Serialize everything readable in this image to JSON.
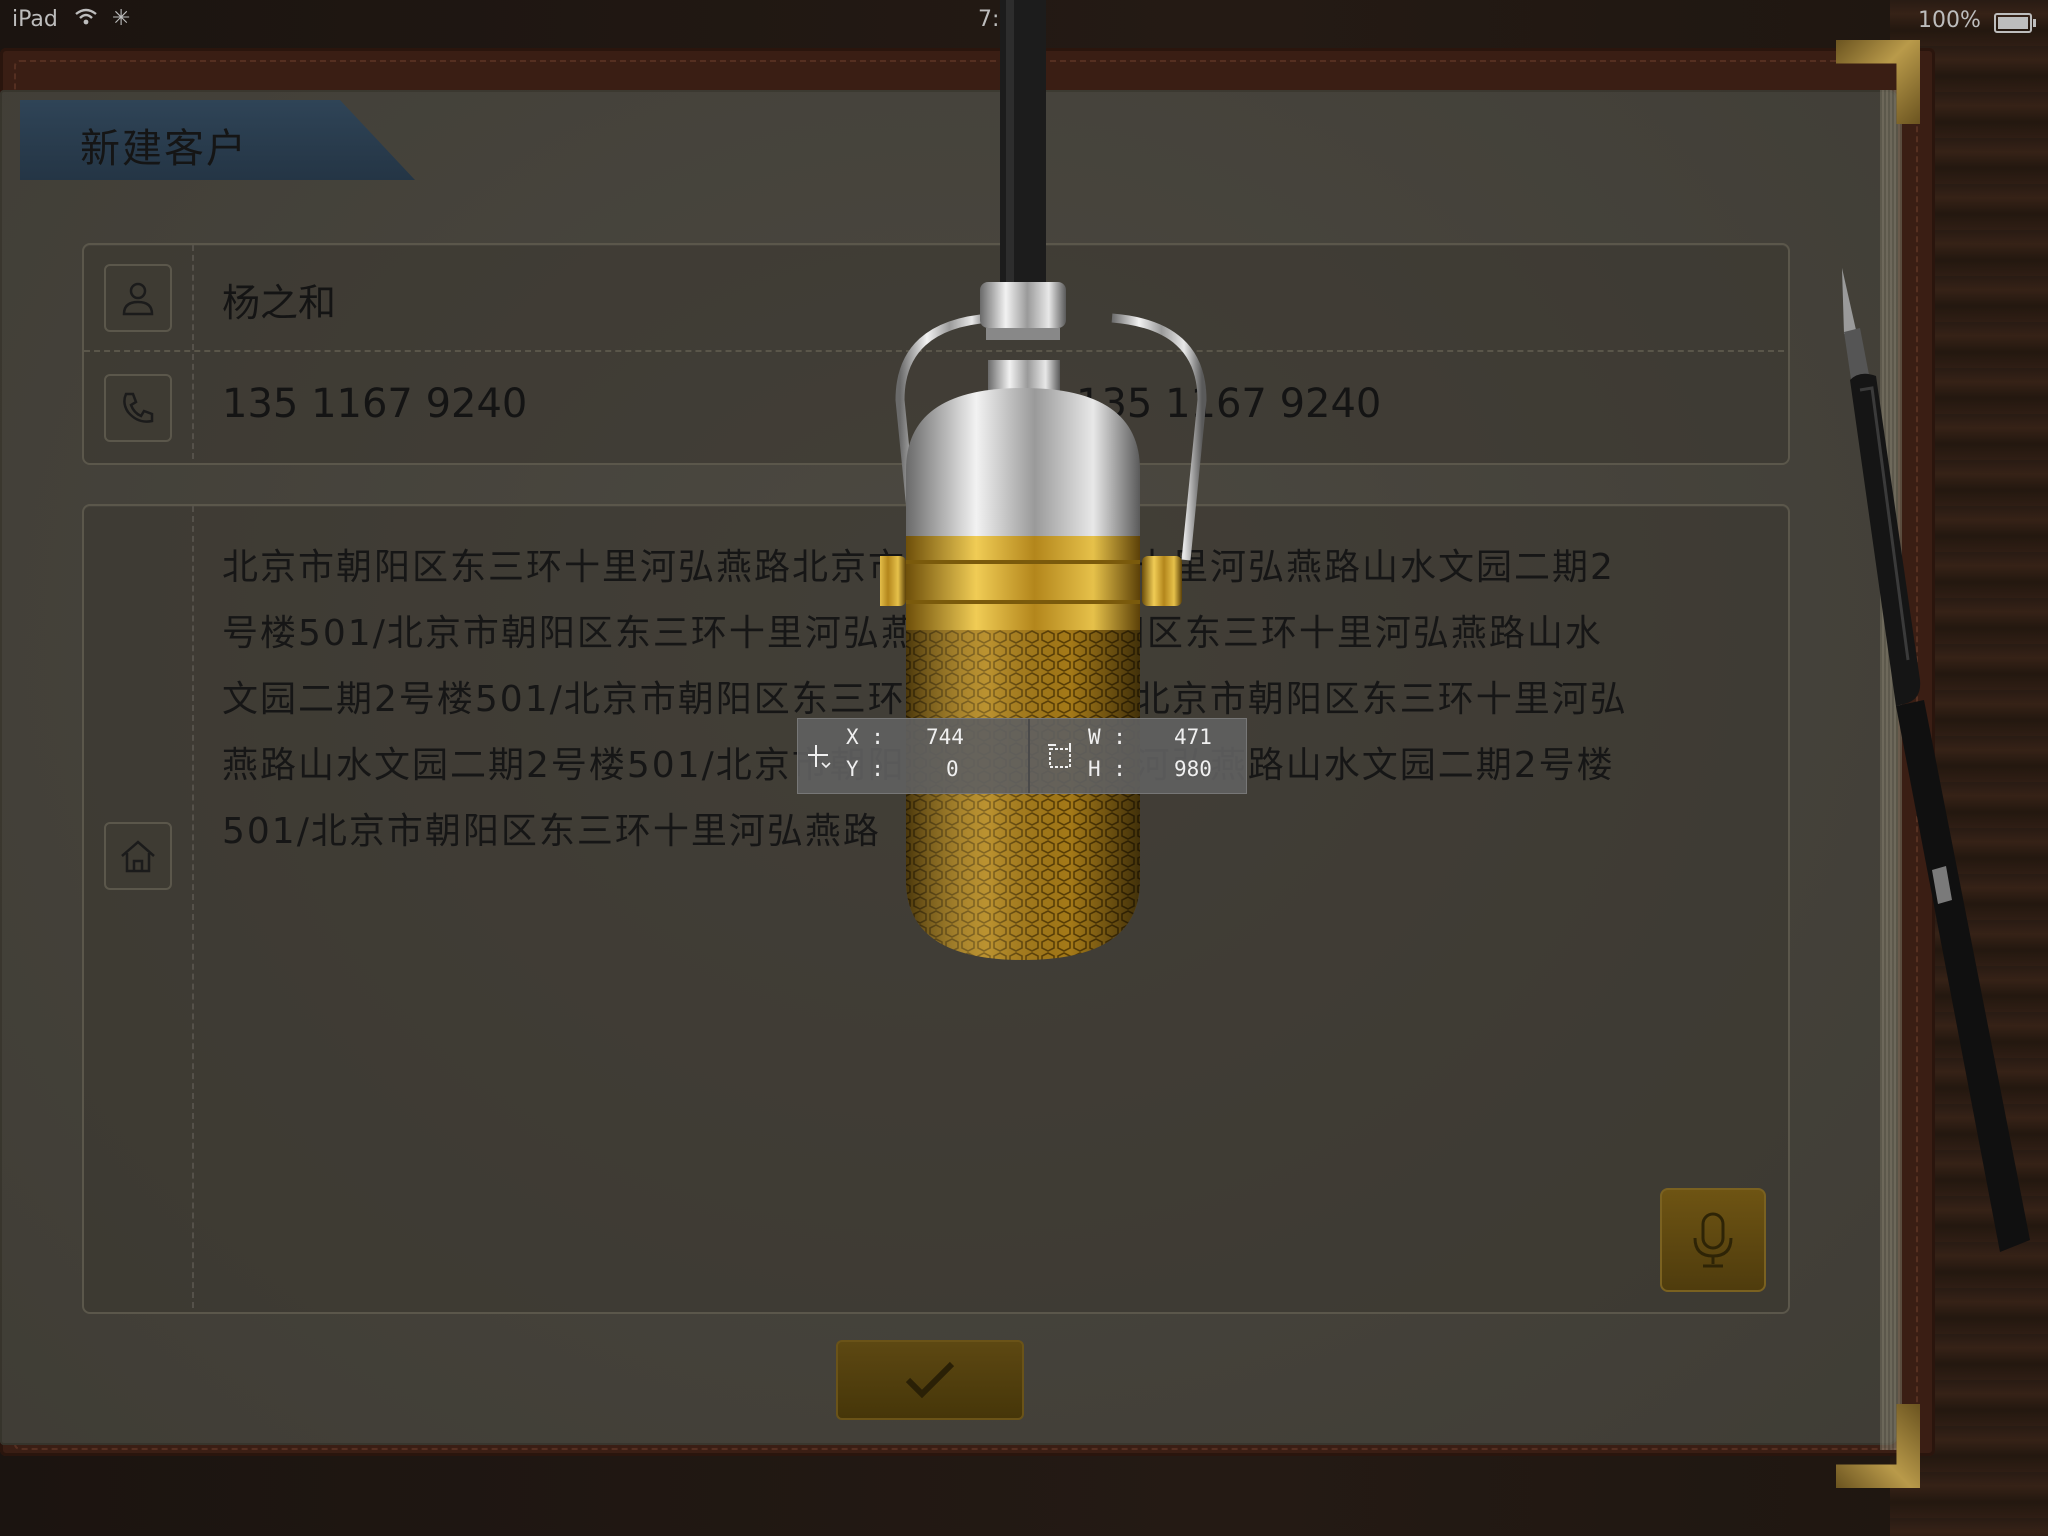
{
  "status_bar": {
    "device": "iPad",
    "time": "7:  m",
    "battery": "100%"
  },
  "form": {
    "title": "新建客户",
    "name": "杨之和",
    "phone": "135 1167 9240",
    "phone_echo": "135 1167 9240",
    "address": "北京市朝阳区东三环十里河弘燕路北京市朝阳区东三环十里河弘燕路山水文园二期2号楼501/北京市朝阳区东三环十里河弘燕路北京市朝阳区东三环十里河弘燕路山水文园二期2号楼501/北京市朝阳区东三环十里河弘燕路北京市朝阳区东三环十里河弘燕路山水文园二期2号楼501/北京市朝阳区东三环十里河弘燕路山水文园二期2号楼501/北京市朝阳区东三环十里河弘燕路"
  },
  "icons": {
    "name": "person-icon",
    "phone": "phone-icon",
    "address": "home-icon",
    "voice": "microphone-icon",
    "confirm": "checkmark-icon"
  },
  "measure_overlay": {
    "x_label": "X :",
    "x_value": "744",
    "y_label": "Y :",
    "y_value": "0",
    "w_label": "W :",
    "w_value": "471",
    "h_label": "H :",
    "h_value": "980"
  },
  "colors": {
    "tab": "#2f4457",
    "gold": "#c8a02a",
    "page": "#45423a"
  }
}
